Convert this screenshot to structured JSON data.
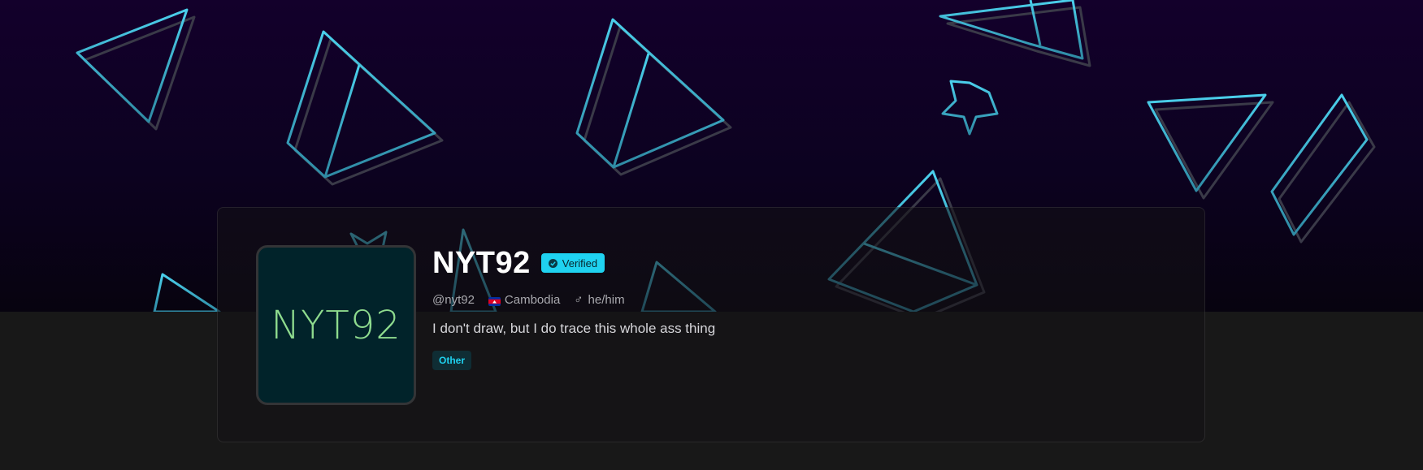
{
  "profile": {
    "avatar_text": "NYT92",
    "display_name": "NYT92",
    "verified_label": "Verified",
    "username": "@nyt92",
    "country": "Cambodia",
    "pronouns": "he/him",
    "bio": "I don't draw, but I do trace this whole ass thing",
    "tags": [
      "Other"
    ]
  },
  "icons": {
    "verified": "check-circle-icon",
    "flag": "cambodia-flag-icon",
    "gender": "male-symbol-icon"
  },
  "colors": {
    "accent": "#1fd2f0",
    "shape_stroke": "#45c8e4",
    "avatar_bg": "#01232a",
    "avatar_text": "#8edb8e",
    "page_bg": "#181818",
    "banner_top": "#13002b"
  }
}
